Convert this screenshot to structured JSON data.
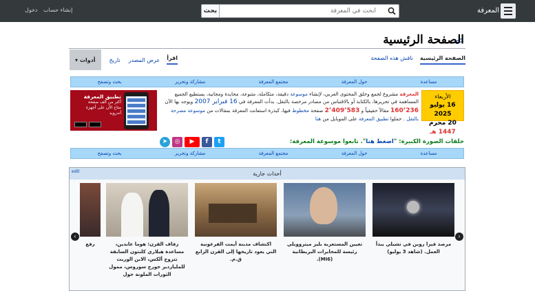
{
  "topbar": {
    "brand": "المعرفة",
    "search_button": "بحث",
    "search_placeholder": "ابحث في المعرفة",
    "login": "دخول",
    "create_account": "إنشاء حساب"
  },
  "page": {
    "title": "الصفحة الرئيسية"
  },
  "tabs": {
    "main_page": "الصفحة الرئيسية",
    "discuss": "ناقش هذه الصفحة",
    "read": "اقرأ",
    "view_source": "عرض المصدر",
    "history": "تاريخ",
    "tools": "أدوات"
  },
  "nav": {
    "items": [
      "بحث وتصفح",
      "مشاركة وتحرير",
      "مجتمع المعرفة",
      "حول المعرفة",
      "مساعدة"
    ]
  },
  "date_box": {
    "weekday": "الأربعاء",
    "gregorian": "16 يوليو 2025",
    "hijri_day": "20 محرم",
    "hijri_year": "1447 هـ"
  },
  "intro": {
    "site": "المعرفة",
    "line1": "مشروع لجمع وخلق المحتوى العربي، لإنشاء",
    "encyclopedia": "موسوعة",
    "line1b": "دقيقة، متكاملة، متنوعة، محايدة ومجانية، يستطيع الجميع",
    "line2": "المساهمة في تحريرها، بالكتابة أو بالاقتباس من مصادر مرخصة بالنقل. بدأت المعرفة في",
    "start_date": "16 فبراير 2007",
    "line2b": "ويوجد بها الآن",
    "article_count": "160٬236",
    "line3a": "مقالاً حقيقياً و",
    "manuscript_count": "2٬409٬583",
    "line3b": "صفحة",
    "manuscript": "مخطوط",
    "line3c": "فيها، كبذرة استعانت المعرفة بمقالات من",
    "licensed": "موسوعة مصرحة بالنقل",
    "line3d": ". حملوا",
    "app_link": "تطبيق المعرفة",
    "line4": "على الموبايل من",
    "here": "هنا"
  },
  "app_banner": {
    "title": "تطبيق المعرفة",
    "subtitle": "أكثر من ألف صفحة",
    "text": "متاح الآن على أجهزة أندرويد"
  },
  "social": {
    "text_before": "حلقات الصورة الكبيرة:",
    "link": "اضغط هنا",
    "text_after": ". تابعوا موسوعة المعرفة:",
    "icons": [
      "twitter-icon",
      "facebook-icon",
      "youtube-icon",
      "instagram-icon",
      "telegram-icon"
    ]
  },
  "events": {
    "title": "أحداث جارية",
    "edit": "edit",
    "cards": [
      {
        "caption": "مرصد فيرا روبن في تشيلي يبدأ العمل. (شاهد 3 يوليو)"
      },
      {
        "caption": "تعيين المستعربة بليز ميتروويلي رئيسة للمخابرات البريطانية (MI6)."
      },
      {
        "caption": "اكتشاف مدينة أيمت الفرعونية التي يعود تاريخها إلى القرن الرابع ق.م."
      },
      {
        "caption": "زفاف القرن: هوما عابدين، مساعدة هيلاري كلنتون السابقة تتزوج ألكس، الابن الوريث للملياردير جورج سوروس، ممول الثورات الملونة حول"
      },
      {
        "caption": "رفع"
      }
    ]
  }
}
